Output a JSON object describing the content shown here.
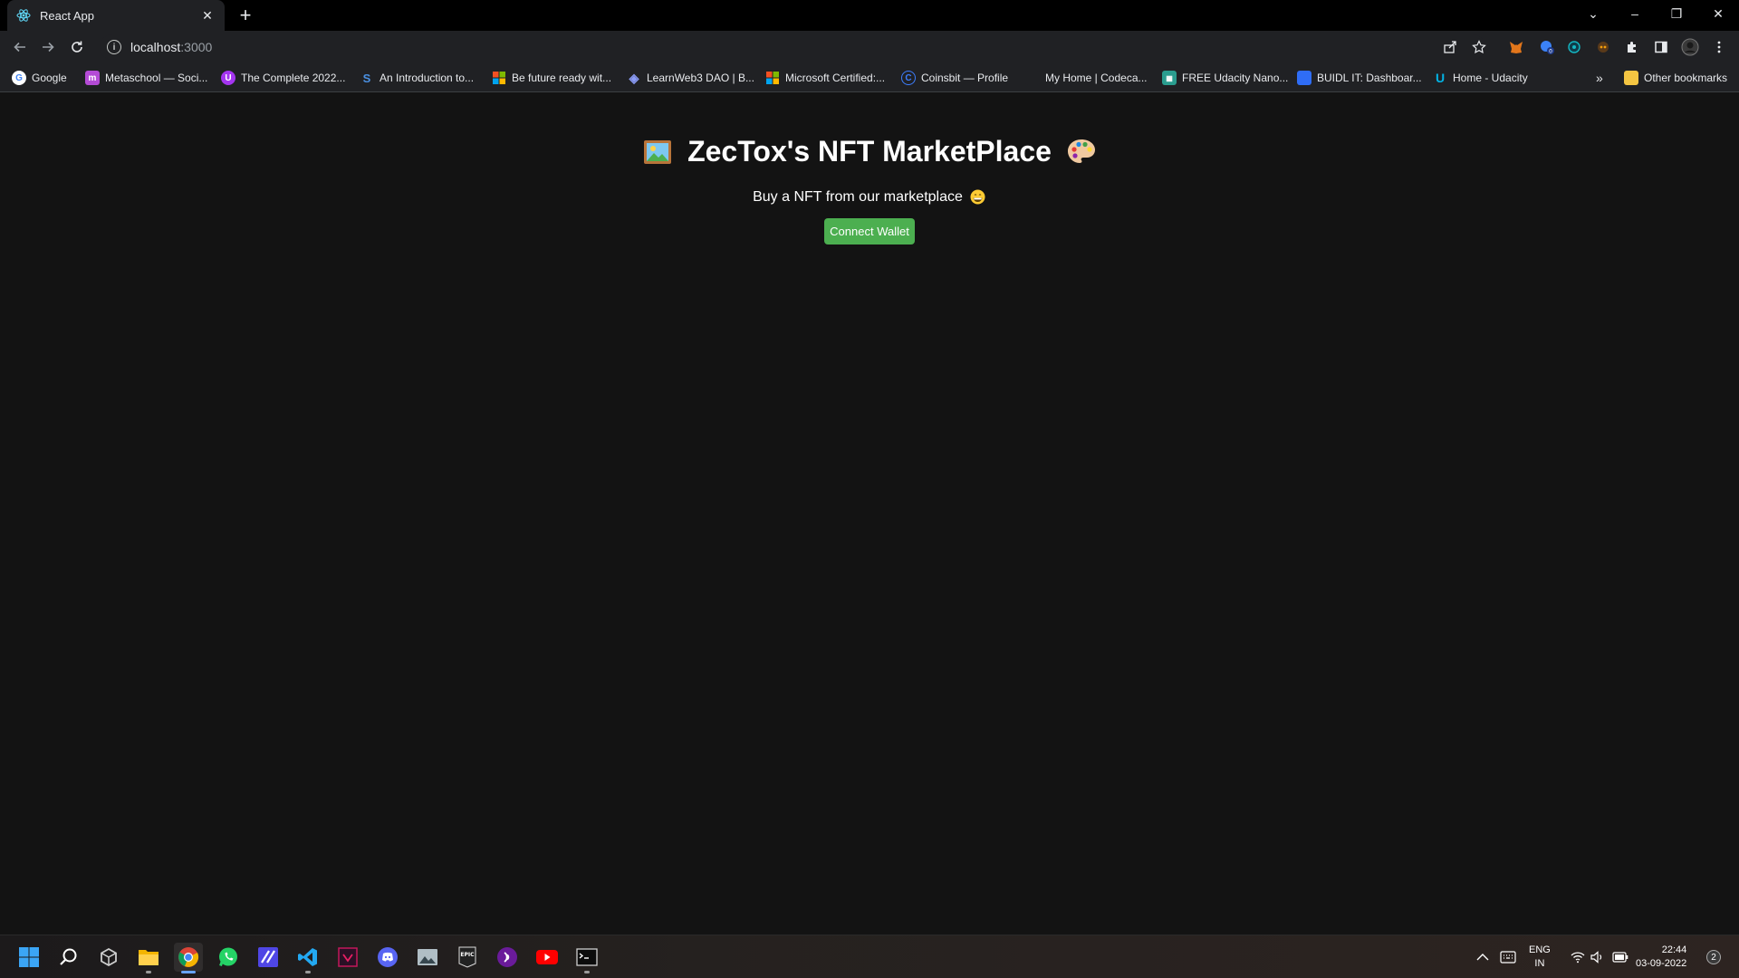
{
  "browser": {
    "tab": {
      "title": "React App",
      "close_glyph": "✕"
    },
    "new_tab_glyph": "+",
    "window_controls": {
      "dropdown": "⌄",
      "minimize": "–",
      "restore": "❐",
      "close": "✕"
    },
    "url": {
      "host": "localhost",
      "port": ":3000"
    },
    "bookmarks": [
      {
        "label": "Google",
        "icon": "google-icon",
        "color": "#ffffff"
      },
      {
        "label": "Metaschool — Soci...",
        "icon": "metaschool-icon",
        "color": "#b44bd6"
      },
      {
        "label": "The Complete 2022...",
        "icon": "udemy-icon",
        "color": "#a435f0"
      },
      {
        "label": "An Introduction to...",
        "icon": "solidity-icon",
        "color": "#4a90e2"
      },
      {
        "label": "Be future ready wit...",
        "icon": "microsoft-icon",
        "color": "#f25022"
      },
      {
        "label": "LearnWeb3 DAO | B...",
        "icon": "learnweb3-icon",
        "color": "#5b6ee1"
      },
      {
        "label": "Microsoft Certified:...",
        "icon": "microsoft-icon",
        "color": "#7fba00"
      },
      {
        "label": "Coinsbit — Profile",
        "icon": "coinsbit-icon",
        "color": "#3d7eff"
      },
      {
        "label": "My Home | Codeca...",
        "icon": "codecademy-icon",
        "color": "#202124"
      },
      {
        "label": "FREE Udacity Nano...",
        "icon": "udacity-icon",
        "color": "#2a9d8f"
      },
      {
        "label": "BUIDL IT: Dashboar...",
        "icon": "buidl-icon",
        "color": "#2f6df6"
      },
      {
        "label": "Home - Udacity",
        "icon": "udacity-icon",
        "color": "#02b3e4"
      }
    ],
    "bookmarks_overflow": "»",
    "other_bookmarks": "Other bookmarks"
  },
  "page": {
    "title_emoji_left": "🖼️",
    "title": "ZecTox's NFT MarketPlace",
    "title_emoji_right": "🎨",
    "subtitle": "Buy a NFT from our marketplace",
    "subtitle_emoji": "😁",
    "connect_button": "Connect Wallet",
    "accent_color": "#4caf50"
  },
  "taskbar": {
    "apps": [
      "windows-start-icon",
      "search-icon",
      "unity-icon",
      "file-explorer-icon",
      "chrome-icon",
      "whatsapp-icon",
      "editor-icon",
      "vscode-icon",
      "app-icon",
      "discord-icon",
      "photos-icon",
      "epic-games-icon",
      "podcast-icon",
      "youtube-icon",
      "terminal-icon"
    ],
    "language": {
      "line1": "ENG",
      "line2": "IN"
    },
    "time": "22:44",
    "date": "03-09-2022",
    "notifications": "2"
  }
}
